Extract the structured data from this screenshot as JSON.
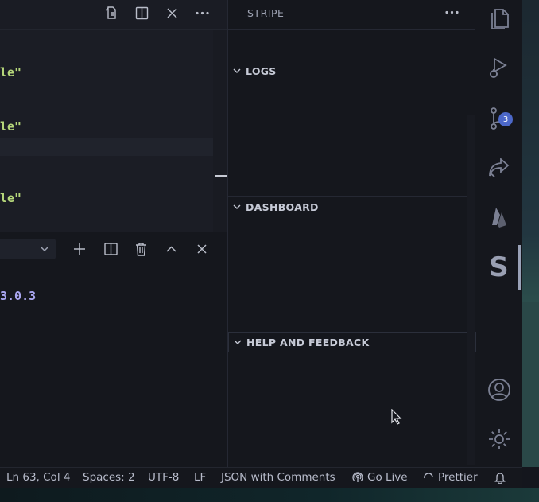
{
  "editor": {
    "lines": [
      "le\"",
      "le\"",
      "le\""
    ],
    "tab_actions": [
      "open-preview-icon",
      "split-editor-icon",
      "close-icon",
      "more-actions-icon"
    ]
  },
  "terminal": {
    "output": "3.0.3",
    "actions": [
      "chevron-down-icon",
      "new-terminal-icon",
      "split-terminal-icon",
      "trash-icon",
      "maximize-panel-icon",
      "close-panel-icon"
    ]
  },
  "sidebar": {
    "title": "STRIPE",
    "sections": [
      {
        "label": "LOGS"
      },
      {
        "label": "DASHBOARD"
      },
      {
        "label": "HELP AND FEEDBACK"
      }
    ]
  },
  "activity_bar": {
    "items": [
      "files-icon",
      "run-debug-icon",
      "source-control-icon",
      "remote-share-icon",
      "firebase-icon",
      "stripe-icon",
      "account-icon",
      "settings-gear-icon"
    ],
    "source_control_badge": "3"
  },
  "statusbar": {
    "position": "Ln 63, Col 4",
    "spaces": "Spaces: 2",
    "encoding": "UTF-8",
    "eol": "LF",
    "language": "JSON with Comments",
    "go_live": "Go Live",
    "prettier": "Prettier"
  },
  "colors": {
    "accent": "#4c68c9",
    "string": "#b5d67a",
    "number": "#a8a5ee",
    "background": "#15171d"
  }
}
